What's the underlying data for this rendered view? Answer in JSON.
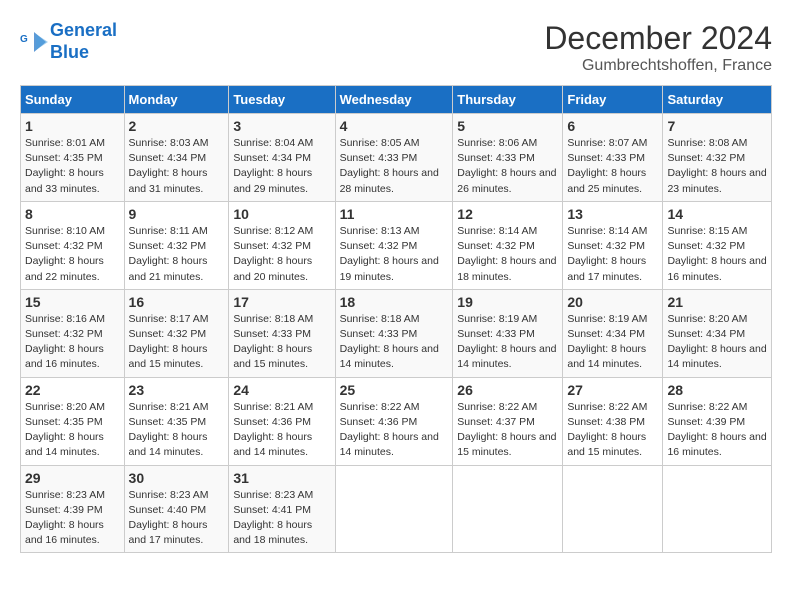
{
  "header": {
    "logo_line1": "General",
    "logo_line2": "Blue",
    "month": "December 2024",
    "location": "Gumbrechtshoffen, France"
  },
  "days_of_week": [
    "Sunday",
    "Monday",
    "Tuesday",
    "Wednesday",
    "Thursday",
    "Friday",
    "Saturday"
  ],
  "weeks": [
    [
      {
        "day": 1,
        "sunrise": "8:01 AM",
        "sunset": "4:35 PM",
        "daylight": "8 hours and 33 minutes."
      },
      {
        "day": 2,
        "sunrise": "8:03 AM",
        "sunset": "4:34 PM",
        "daylight": "8 hours and 31 minutes."
      },
      {
        "day": 3,
        "sunrise": "8:04 AM",
        "sunset": "4:34 PM",
        "daylight": "8 hours and 29 minutes."
      },
      {
        "day": 4,
        "sunrise": "8:05 AM",
        "sunset": "4:33 PM",
        "daylight": "8 hours and 28 minutes."
      },
      {
        "day": 5,
        "sunrise": "8:06 AM",
        "sunset": "4:33 PM",
        "daylight": "8 hours and 26 minutes."
      },
      {
        "day": 6,
        "sunrise": "8:07 AM",
        "sunset": "4:33 PM",
        "daylight": "8 hours and 25 minutes."
      },
      {
        "day": 7,
        "sunrise": "8:08 AM",
        "sunset": "4:32 PM",
        "daylight": "8 hours and 23 minutes."
      }
    ],
    [
      {
        "day": 8,
        "sunrise": "8:10 AM",
        "sunset": "4:32 PM",
        "daylight": "8 hours and 22 minutes."
      },
      {
        "day": 9,
        "sunrise": "8:11 AM",
        "sunset": "4:32 PM",
        "daylight": "8 hours and 21 minutes."
      },
      {
        "day": 10,
        "sunrise": "8:12 AM",
        "sunset": "4:32 PM",
        "daylight": "8 hours and 20 minutes."
      },
      {
        "day": 11,
        "sunrise": "8:13 AM",
        "sunset": "4:32 PM",
        "daylight": "8 hours and 19 minutes."
      },
      {
        "day": 12,
        "sunrise": "8:14 AM",
        "sunset": "4:32 PM",
        "daylight": "8 hours and 18 minutes."
      },
      {
        "day": 13,
        "sunrise": "8:14 AM",
        "sunset": "4:32 PM",
        "daylight": "8 hours and 17 minutes."
      },
      {
        "day": 14,
        "sunrise": "8:15 AM",
        "sunset": "4:32 PM",
        "daylight": "8 hours and 16 minutes."
      }
    ],
    [
      {
        "day": 15,
        "sunrise": "8:16 AM",
        "sunset": "4:32 PM",
        "daylight": "8 hours and 16 minutes."
      },
      {
        "day": 16,
        "sunrise": "8:17 AM",
        "sunset": "4:32 PM",
        "daylight": "8 hours and 15 minutes."
      },
      {
        "day": 17,
        "sunrise": "8:18 AM",
        "sunset": "4:33 PM",
        "daylight": "8 hours and 15 minutes."
      },
      {
        "day": 18,
        "sunrise": "8:18 AM",
        "sunset": "4:33 PM",
        "daylight": "8 hours and 14 minutes."
      },
      {
        "day": 19,
        "sunrise": "8:19 AM",
        "sunset": "4:33 PM",
        "daylight": "8 hours and 14 minutes."
      },
      {
        "day": 20,
        "sunrise": "8:19 AM",
        "sunset": "4:34 PM",
        "daylight": "8 hours and 14 minutes."
      },
      {
        "day": 21,
        "sunrise": "8:20 AM",
        "sunset": "4:34 PM",
        "daylight": "8 hours and 14 minutes."
      }
    ],
    [
      {
        "day": 22,
        "sunrise": "8:20 AM",
        "sunset": "4:35 PM",
        "daylight": "8 hours and 14 minutes."
      },
      {
        "day": 23,
        "sunrise": "8:21 AM",
        "sunset": "4:35 PM",
        "daylight": "8 hours and 14 minutes."
      },
      {
        "day": 24,
        "sunrise": "8:21 AM",
        "sunset": "4:36 PM",
        "daylight": "8 hours and 14 minutes."
      },
      {
        "day": 25,
        "sunrise": "8:22 AM",
        "sunset": "4:36 PM",
        "daylight": "8 hours and 14 minutes."
      },
      {
        "day": 26,
        "sunrise": "8:22 AM",
        "sunset": "4:37 PM",
        "daylight": "8 hours and 15 minutes."
      },
      {
        "day": 27,
        "sunrise": "8:22 AM",
        "sunset": "4:38 PM",
        "daylight": "8 hours and 15 minutes."
      },
      {
        "day": 28,
        "sunrise": "8:22 AM",
        "sunset": "4:39 PM",
        "daylight": "8 hours and 16 minutes."
      }
    ],
    [
      {
        "day": 29,
        "sunrise": "8:23 AM",
        "sunset": "4:39 PM",
        "daylight": "8 hours and 16 minutes."
      },
      {
        "day": 30,
        "sunrise": "8:23 AM",
        "sunset": "4:40 PM",
        "daylight": "8 hours and 17 minutes."
      },
      {
        "day": 31,
        "sunrise": "8:23 AM",
        "sunset": "4:41 PM",
        "daylight": "8 hours and 18 minutes."
      },
      null,
      null,
      null,
      null
    ]
  ],
  "labels": {
    "sunrise": "Sunrise:",
    "sunset": "Sunset:",
    "daylight": "Daylight:"
  }
}
